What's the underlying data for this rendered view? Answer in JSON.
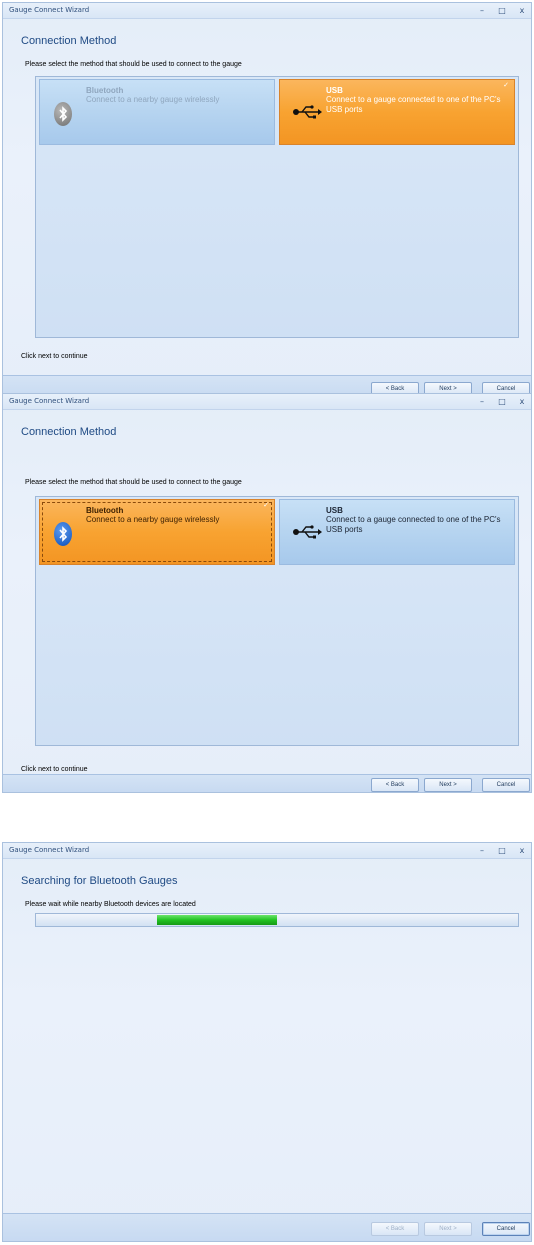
{
  "screens": [
    {
      "window_title": "Gauge Connect Wizard",
      "heading": "Connection Method",
      "instruction": "Please select the method that should be used to connect to the gauge",
      "options": [
        {
          "title": "Bluetooth",
          "description": "Connect to a nearby gauge wirelessly",
          "state": "normal"
        },
        {
          "title": "USB",
          "description": "Connect to a gauge connected to one of the PC's USB ports",
          "state": "selected"
        }
      ],
      "status": "Click next to continue",
      "buttons": {
        "back": "< Back",
        "next": "Next >",
        "cancel": "Cancel"
      }
    },
    {
      "window_title": "Gauge Connect Wizard",
      "heading": "Connection Method",
      "instruction": "Please select the method that should be used to connect to the gauge",
      "options": [
        {
          "title": "Bluetooth",
          "description": "Connect to a nearby gauge wirelessly",
          "state": "selected"
        },
        {
          "title": "USB",
          "description": "Connect to a gauge connected to one of the PC's USB ports",
          "state": "normal"
        }
      ],
      "status": "Click next to continue",
      "buttons": {
        "back": "< Back",
        "next": "Next >",
        "cancel": "Cancel"
      }
    },
    {
      "window_title": "Gauge Connect Wizard",
      "heading": "Searching for Bluetooth Gauges",
      "instruction": "Please wait while nearby Bluetooth devices are located",
      "progress": {
        "indeterminate": true,
        "segment_start_fraction": 0.25,
        "segment_end_fraction": 0.5
      },
      "buttons": {
        "back": "< Back",
        "next": "Next >",
        "cancel": "Cancel",
        "back_enabled": false,
        "next_enabled": false
      }
    }
  ],
  "window_controls": {
    "minimize": "–",
    "maximize": "□",
    "close": "x"
  },
  "icons": {
    "bluetooth": "bluetooth-icon",
    "usb": "usb-icon",
    "check": "checkmark-icon"
  },
  "colors": {
    "selected_tile": "#f8a331",
    "normal_tile": "#b6d4f0",
    "progress": "#22c322",
    "heading": "#1f4a84"
  }
}
